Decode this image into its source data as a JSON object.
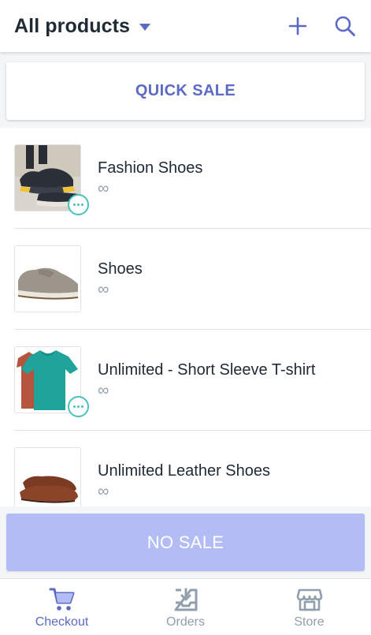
{
  "header": {
    "title": "All products",
    "dropdown_icon": "caret-down-icon",
    "add_icon": "plus-icon",
    "search_icon": "search-icon"
  },
  "quick_sale": {
    "label": "QUICK SALE"
  },
  "products": [
    {
      "name": "Fashion Shoes",
      "stock": "∞",
      "image": "sneaker-photo",
      "has_variants": true
    },
    {
      "name": "Shoes",
      "stock": "∞",
      "image": "suede-shoe-photo",
      "has_variants": false
    },
    {
      "name": "Unlimited - Short Sleeve T-shirt",
      "stock": "∞",
      "image": "tshirts-photo",
      "has_variants": true
    },
    {
      "name": "Unlimited Leather Shoes",
      "stock": "∞",
      "image": "leather-shoes-photo",
      "has_variants": false
    }
  ],
  "no_sale": {
    "label": "NO SALE"
  },
  "tabs": [
    {
      "label": "Checkout",
      "icon": "cart-icon",
      "active": true
    },
    {
      "label": "Orders",
      "icon": "inbox-download-icon",
      "active": false
    },
    {
      "label": "Store",
      "icon": "storefront-icon",
      "active": false
    }
  ],
  "colors": {
    "accent": "#5c6ac4",
    "disabled_button": "#b3bcf5",
    "badge": "#47c1bf",
    "muted": "#919eab"
  }
}
